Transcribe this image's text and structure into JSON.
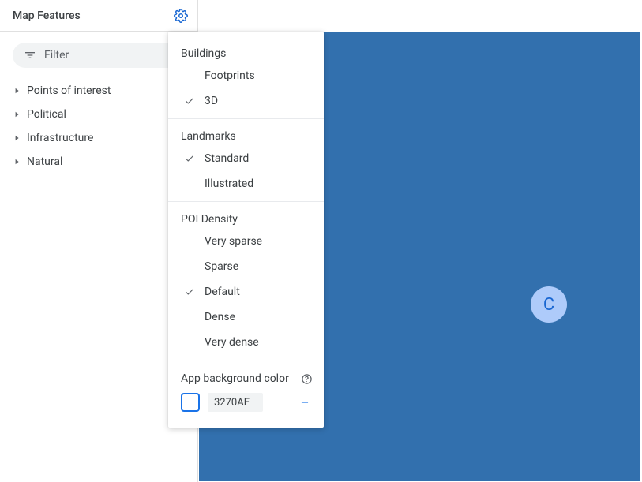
{
  "colors": {
    "app_background": "#3270AE",
    "accent": "#1a73e8"
  },
  "sidebar": {
    "title": "Map Features",
    "filter_placeholder": "Filter",
    "tree": [
      {
        "label": "Points of interest"
      },
      {
        "label": "Political"
      },
      {
        "label": "Infrastructure"
      },
      {
        "label": "Natural"
      }
    ]
  },
  "popup": {
    "sections": [
      {
        "title": "Buildings",
        "items": [
          {
            "label": "Footprints",
            "selected": false
          },
          {
            "label": "3D",
            "selected": true
          }
        ]
      },
      {
        "title": "Landmarks",
        "items": [
          {
            "label": "Standard",
            "selected": true
          },
          {
            "label": "Illustrated",
            "selected": false
          }
        ]
      },
      {
        "title": "POI Density",
        "items": [
          {
            "label": "Very sparse",
            "selected": false
          },
          {
            "label": "Sparse",
            "selected": false
          },
          {
            "label": "Default",
            "selected": true
          },
          {
            "label": "Dense",
            "selected": false
          },
          {
            "label": "Very dense",
            "selected": false
          }
        ]
      }
    ],
    "app_bg": {
      "label": "App background color",
      "hex": "3270AE"
    }
  },
  "map": {
    "avatar_letter": "C"
  }
}
